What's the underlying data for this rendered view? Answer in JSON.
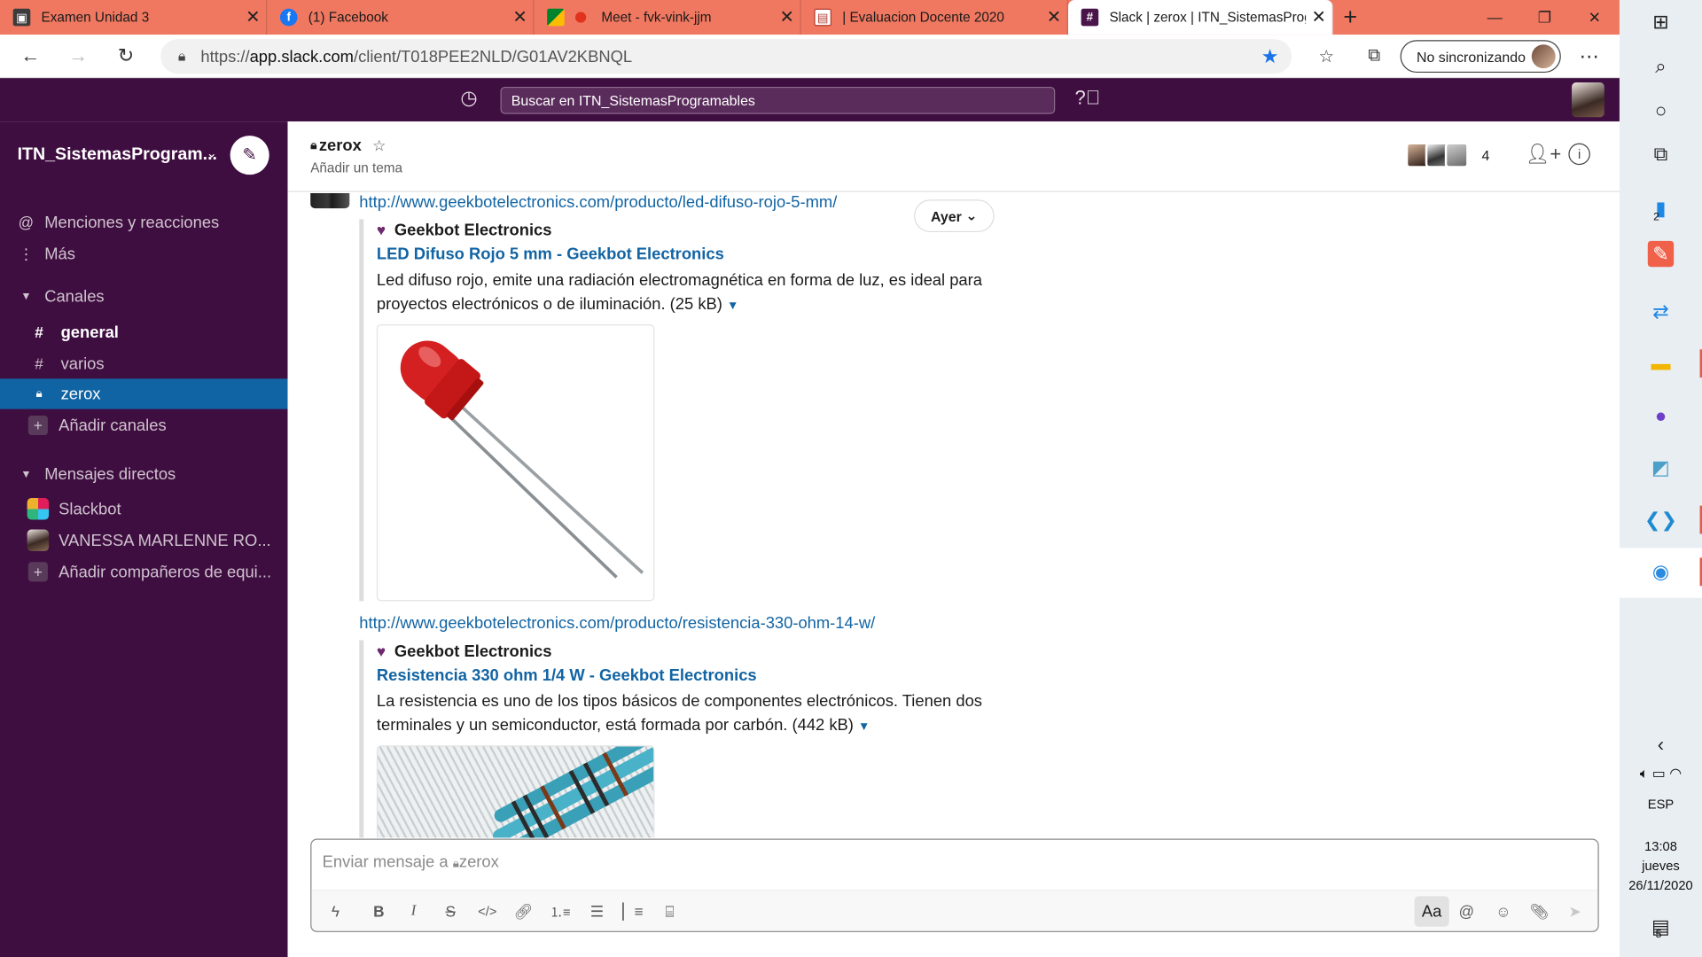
{
  "browser": {
    "tabs": [
      {
        "label": "Examen Unidad 3",
        "favicon_color": "#3c3c3c",
        "icon": "classroom-icon",
        "active": false
      },
      {
        "label": "(1) Facebook",
        "favicon_color": "#1877f2",
        "icon": "facebook-icon",
        "active": false
      },
      {
        "label": "Meet - fvk-vink-jjm",
        "favicon_color": "#00832d",
        "icon": "meet-icon",
        "active": false
      },
      {
        "label": "| Evaluacion Docente 2020",
        "favicon_color": "#b03a2e",
        "icon": "document-icon",
        "active": false
      },
      {
        "label": "Slack | zerox | ITN_SistemasProgr",
        "favicon_color": "#4a154b",
        "icon": "slack-icon",
        "active": true
      }
    ],
    "url_prefix": "https://",
    "url_host": "app.slack.com",
    "url_path": "/client/T018PEE2NLD/G01AV2KBNQL",
    "profile_label": "No sincronizando"
  },
  "slack_top": {
    "search_placeholder": "Buscar en ITN_SistemasProgramables"
  },
  "sidebar": {
    "workspace": "ITN_SistemasProgram...",
    "mentions": "Menciones y reacciones",
    "more": "Más",
    "channels_header": "Canales",
    "channels": [
      {
        "name": "general",
        "icon": "#",
        "bold": true,
        "active": false
      },
      {
        "name": "varios",
        "icon": "#",
        "bold": false,
        "active": false
      },
      {
        "name": "zerox",
        "icon": "lock",
        "bold": false,
        "active": true
      }
    ],
    "add_channels": "Añadir canales",
    "dm_header": "Mensajes directos",
    "dms": [
      {
        "name": "Slackbot"
      },
      {
        "name": "VANESSA MARLENNE RO..."
      }
    ],
    "add_teammates": "Añadir compañeros de equi..."
  },
  "channel": {
    "name": "zerox",
    "topic": "Añadir un tema",
    "member_count": "4"
  },
  "messages": {
    "day_label": "Ayer",
    "links": [
      {
        "url": "http://www.geekbotelectronics.com/producto/led-difuso-rojo-5-mm/",
        "source": "Geekbot Electronics",
        "title": "LED Difuso Rojo 5 mm - Geekbot Electronics",
        "description": "Led difuso rojo, emite una radiación electromagnética en forma de luz, es ideal para proyectos electrónicos o de iluminación. (25 kB)"
      },
      {
        "url": "http://www.geekbotelectronics.com/producto/resistencia-330-ohm-14-w/",
        "source": "Geekbot Electronics",
        "title": "Resistencia 330 ohm 1/4 W - Geekbot Electronics",
        "description": "La resistencia es uno de los tipos básicos de componentes electrónicos. Tienen dos terminales y un semiconductor, está formada por carbón. (442 kB)"
      }
    ]
  },
  "composer": {
    "placeholder": "Enviar mensaje a",
    "channel": "zerox",
    "aa_label": "Aa"
  },
  "taskbar": {
    "lang": "ESP",
    "time": "13:08",
    "day": "jueves",
    "date": "26/11/2020",
    "store_badge": "2",
    "notif_badge": "5"
  }
}
